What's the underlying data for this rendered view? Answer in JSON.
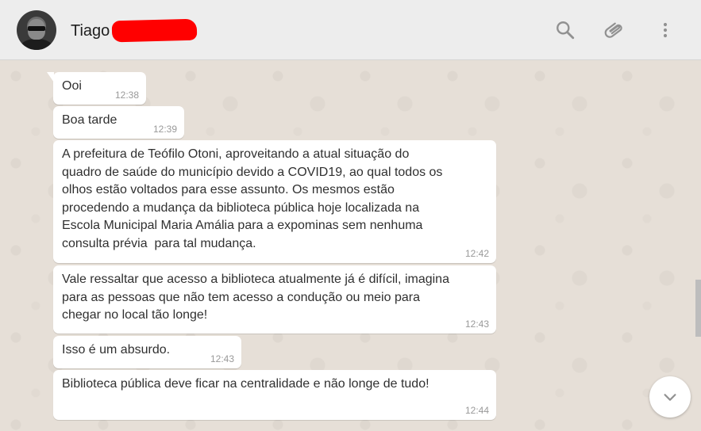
{
  "header": {
    "contact_name": "Tiago",
    "icons": {
      "search": "search-icon",
      "attach": "paperclip-icon",
      "menu": "kebab-menu-icon"
    }
  },
  "colors": {
    "header_bg": "#ededed",
    "chat_bg": "#e6dfd7",
    "bubble_bg": "#ffffff",
    "redaction": "#ff0000",
    "icon": "#919191"
  },
  "messages": [
    {
      "text": "Ooi",
      "time": "12:38"
    },
    {
      "text": "Boa tarde",
      "time": "12:39"
    },
    {
      "text": "A prefeitura de Teófilo Otoni, aproveitando a atual situação do\nquadro de saúde do município devido a COVID19, ao qual todos os\nolhos estão voltados para esse assunto. Os mesmos estão\nprocedendo a mudança da biblioteca pública hoje localizada na\nEscola Municipal Maria Amália para a expominas sem nenhuma\nconsulta prévia  para tal mudança.",
      "time": "12:42"
    },
    {
      "text": "Vale ressaltar que acesso a biblioteca atualmente já é difícil, imagina\npara as pessoas que não tem acesso a condução ou meio para\nchegar no local tão longe!",
      "time": "12:43"
    },
    {
      "text": "Isso é um absurdo.",
      "time": "12:43"
    },
    {
      "text": "Biblioteca pública deve ficar na centralidade e não longe de tudo!",
      "time": "12:44"
    }
  ],
  "scroll_down_icon": "chevron-down-icon"
}
